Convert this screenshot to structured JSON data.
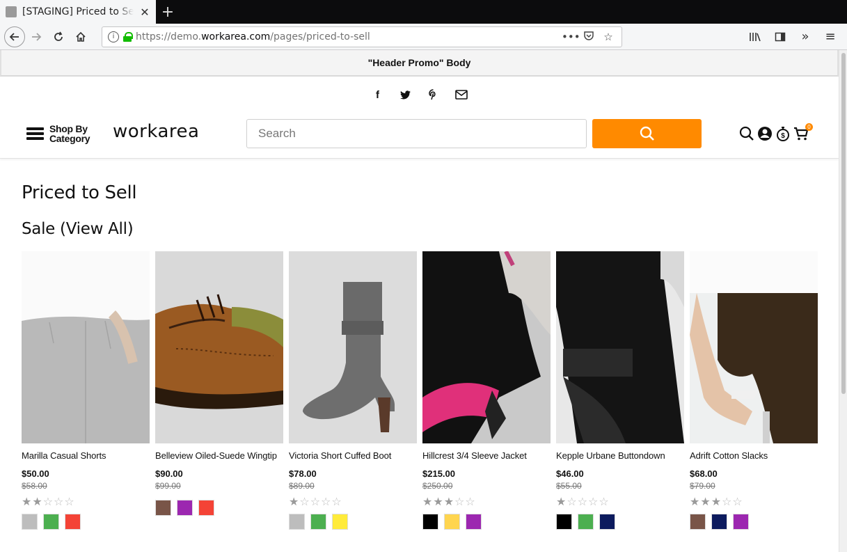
{
  "browser": {
    "tab_title": "[STAGING] Priced to Sell",
    "url_prefix": "https://demo.",
    "url_domain": "workarea.com",
    "url_path": "/pages/priced-to-sell"
  },
  "promo": {
    "text": "\"Header Promo\" Body"
  },
  "header": {
    "menu_label": "Shop By Category",
    "logo": "workarea",
    "search_placeholder": "Search",
    "cart_count": "0"
  },
  "page": {
    "title": "Priced to Sell",
    "section_title": "Sale (View All)"
  },
  "colors": {
    "accent": "#ff8a00"
  },
  "products": [
    {
      "name": "Marilla Casual Shorts",
      "price": "$50.00",
      "old_price": "$58.00",
      "rating": 2,
      "swatches": [
        "#bdbdbd",
        "#4caf50",
        "#f44336"
      ]
    },
    {
      "name": "Belleview Oiled-Suede Wingtip",
      "price": "$90.00",
      "old_price": "$99.00",
      "rating": 0,
      "swatches": [
        "#795548",
        "#9c27b0",
        "#f44336"
      ]
    },
    {
      "name": "Victoria Short Cuffed Boot",
      "price": "$78.00",
      "old_price": "$89.00",
      "rating": 1,
      "swatches": [
        "#bdbdbd",
        "#4caf50",
        "#ffeb3b"
      ]
    },
    {
      "name": "Hillcrest 3/4 Sleeve Jacket",
      "price": "$215.00",
      "old_price": "$250.00",
      "rating": 3,
      "swatches": [
        "#000000",
        "#ffd54f",
        "#9c27b0"
      ]
    },
    {
      "name": "Kepple Urbane Buttondown",
      "price": "$46.00",
      "old_price": "$55.00",
      "rating": 1,
      "swatches": [
        "#000000",
        "#4caf50",
        "#0d1b5e"
      ]
    },
    {
      "name": "Adrift Cotton Slacks",
      "price": "$68.00",
      "old_price": "$79.00",
      "rating": 3,
      "swatches": [
        "#795548",
        "#0d1b5e",
        "#9c27b0"
      ]
    }
  ]
}
